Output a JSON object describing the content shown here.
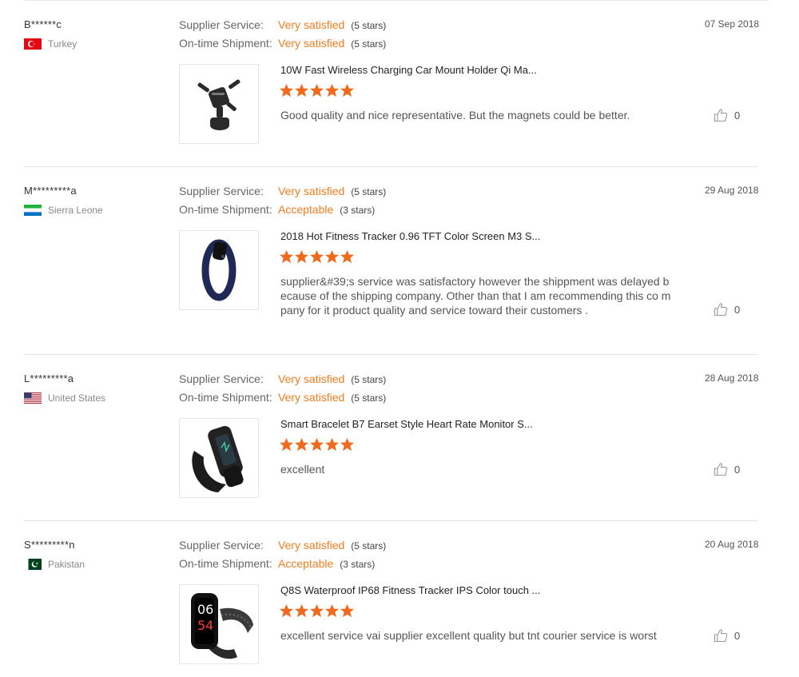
{
  "labels": {
    "supplier_service": "Supplier Service:",
    "ontime_shipment": "On-time Shipment:"
  },
  "colors": {
    "accent": "#f07c1e",
    "divider": "#e3e3e3"
  },
  "reviews": [
    {
      "user": "B******c",
      "country": "Turkey",
      "flag": "turkey-flag-icon",
      "supplier_value": "Very satisfied",
      "supplier_stars": "(5 stars)",
      "shipment_value": "Very satisfied",
      "shipment_stars": "(5 stars)",
      "date": "07 Sep 2018",
      "product_title": "10W Fast Wireless Charging Car Mount Holder Qi Ma...",
      "rating": 5,
      "text": "Good quality and nice representative. But the magnets could be better.",
      "likes": "0",
      "product_icon": "car-mount-holder-image"
    },
    {
      "user": "M*********a",
      "country": "Sierra Leone",
      "flag": "sierra-leone-flag-icon",
      "supplier_value": "Very satisfied",
      "supplier_stars": "(5 stars)",
      "shipment_value": "Acceptable",
      "shipment_stars": "(3 stars)",
      "date": "29 Aug 2018",
      "product_title": "2018 Hot Fitness Tracker 0.96 TFT Color Screen M3 S...",
      "rating": 5,
      "text": "supplier&#39;s service was satisfactory however the shippment was delayed b ecause of  the shipping company. Other than that I am recommending this co mpany for it product quality and service toward their customers .",
      "likes": "0",
      "product_icon": "fitness-band-image"
    },
    {
      "user": "L*********a",
      "country": "United States",
      "flag": "us-flag-icon",
      "supplier_value": "Very satisfied",
      "supplier_stars": "(5 stars)",
      "shipment_value": "Very satisfied",
      "shipment_stars": "(5 stars)",
      "date": "28 Aug 2018",
      "product_title": "Smart Bracelet B7 Earset Style Heart Rate Monitor S...",
      "rating": 5,
      "text": "excellent",
      "likes": "0",
      "product_icon": "smart-bracelet-image"
    },
    {
      "user": "S*********n",
      "country": "Pakistan",
      "flag": "pakistan-flag-icon",
      "supplier_value": "Very satisfied",
      "supplier_stars": "(5 stars)",
      "shipment_value": "Acceptable",
      "shipment_stars": "(3 stars)",
      "date": "20 Aug 2018",
      "product_title": "Q8S Waterproof IP68 Fitness Tracker IPS Color touch ...",
      "rating": 5,
      "text": "excellent service vai supplier excellent quality but tnt courier service is worst",
      "likes": "0",
      "product_icon": "fitness-tracker-image",
      "product_screen_text_1": "06",
      "product_screen_text_2": "54"
    }
  ]
}
